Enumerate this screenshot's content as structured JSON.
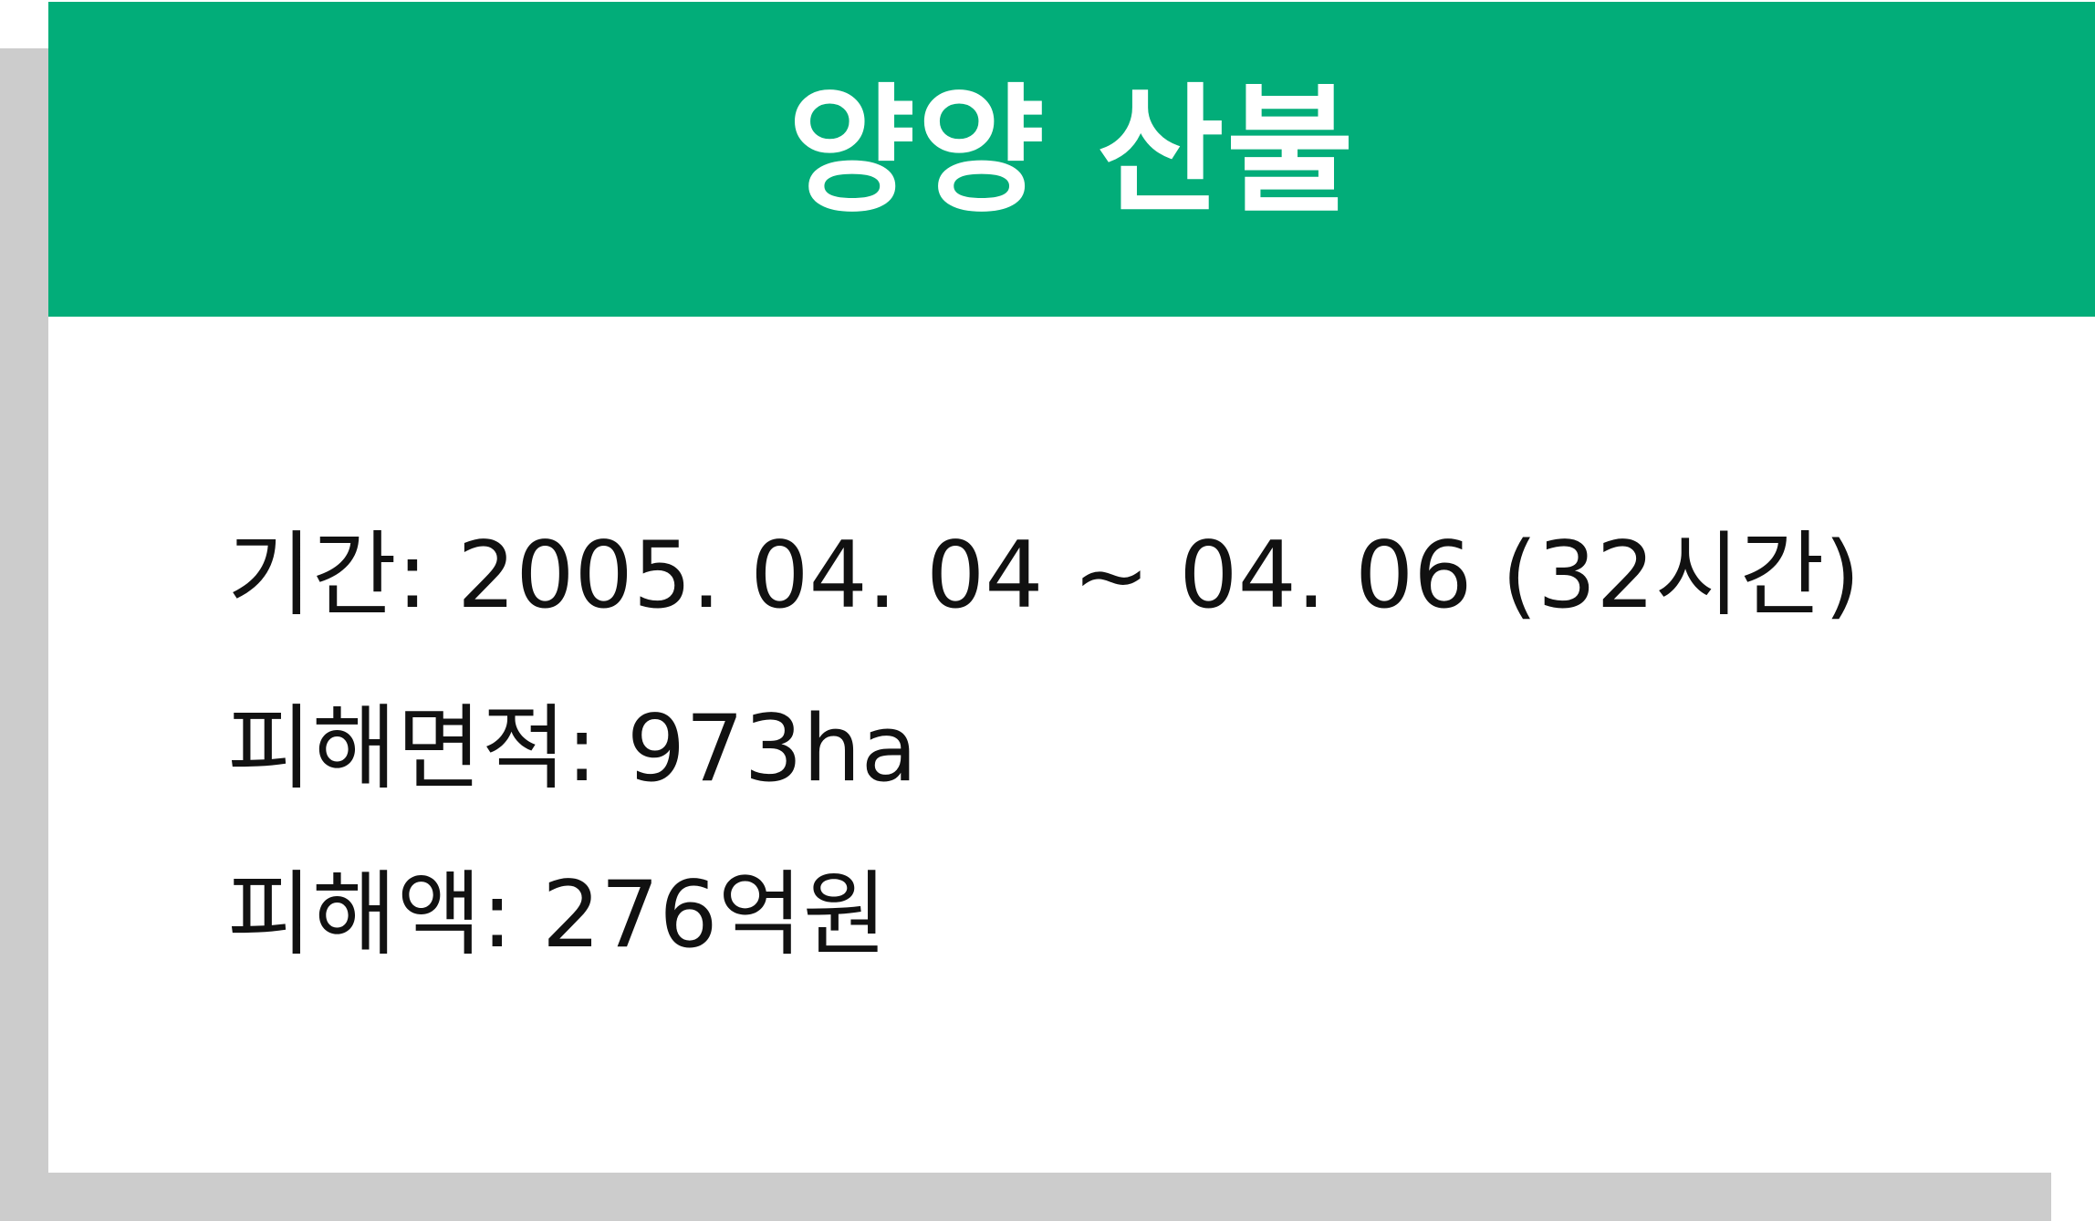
{
  "card": {
    "title": "양양 산불",
    "lines": [
      "기간: 2005. 04. 04 ~ 04. 06 (32시간)",
      "피해면적: 973ha",
      "피해액: 276억원"
    ]
  },
  "colors": {
    "header_background": "#02ad79",
    "header_text": "#ffffff",
    "body_background": "#ffffff",
    "body_text": "#111111",
    "shadow": "#cccccc"
  }
}
